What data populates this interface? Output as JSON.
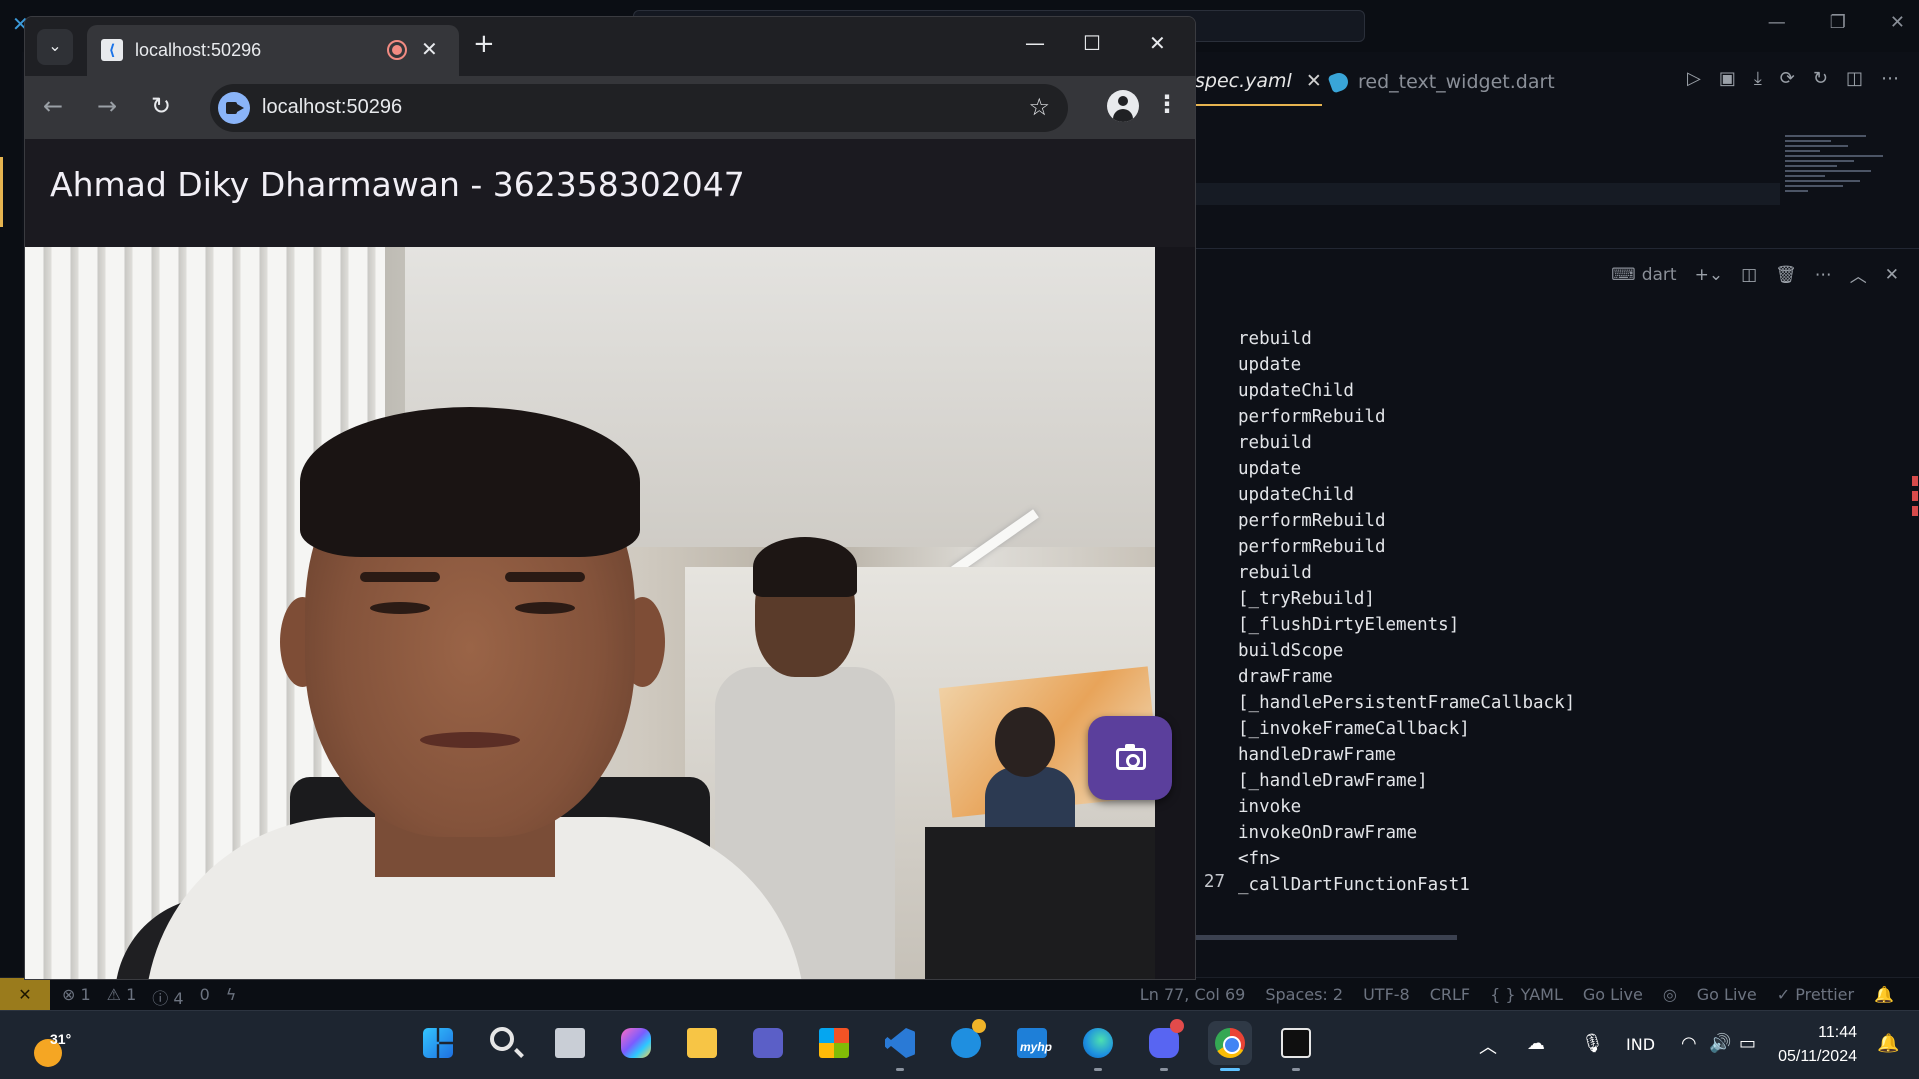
{
  "vscode": {
    "tabs": [
      {
        "label": "spec.yaml",
        "active": true,
        "close": "✕"
      },
      {
        "label": "red_text_widget.dart",
        "active": false
      }
    ],
    "terminal": {
      "name": "dart",
      "lines": [
        "rebuild",
        "update",
        "updateChild",
        "performRebuild",
        "rebuild",
        "update",
        "updateChild",
        "performRebuild",
        "performRebuild",
        "rebuild",
        "[_tryRebuild]",
        "[_flushDirtyElements]",
        "buildScope",
        "drawFrame",
        "[_handlePersistentFrameCallback]",
        "[_invokeFrameCallback]",
        "handleDrawFrame",
        "[_handleDrawFrame]",
        "invoke",
        "invokeOnDrawFrame",
        "<fn>",
        "_callDartFunctionFast1"
      ],
      "line_number": "27"
    },
    "status": {
      "errors": "⊗ 1",
      "warnings": "⚠ 1",
      "info": "ⓘ 4",
      "ports": "0",
      "position": "Ln 77, Col 69",
      "spaces": "Spaces: 2",
      "encoding": "UTF-8",
      "eol": "CRLF",
      "language": "{ } YAML",
      "go_live_1": "Go Live",
      "go_live_2": "Go Live",
      "prettier": "✓ Prettier"
    }
  },
  "browser": {
    "tab_title": "localhost:50296",
    "tab_close": "✕",
    "new_tab": "+",
    "url": "localhost:50296",
    "controls": {
      "minimize": "—",
      "maximize": "☐",
      "close": "✕"
    },
    "nav": {
      "back": "←",
      "forward": "→",
      "reload": "↻"
    },
    "bookmark": "☆",
    "menu": "⋮"
  },
  "app": {
    "title": "Ahmad Diky Dharmawan - 362358302047",
    "capture_button_icon": "camera-icon",
    "accent_color": "#5b3f9c"
  },
  "taskbar": {
    "weather_temp": "31°",
    "pinned": [
      "start",
      "search",
      "task-view",
      "copilot",
      "file-explorer",
      "teams",
      "microsoft-store",
      "vs-code",
      "get-help",
      "myhp",
      "edge",
      "discord",
      "chrome",
      "app-cube"
    ],
    "myhp_label": "myhp",
    "tray": {
      "language": "IND",
      "time": "11:44",
      "date": "05/11/2024"
    }
  }
}
